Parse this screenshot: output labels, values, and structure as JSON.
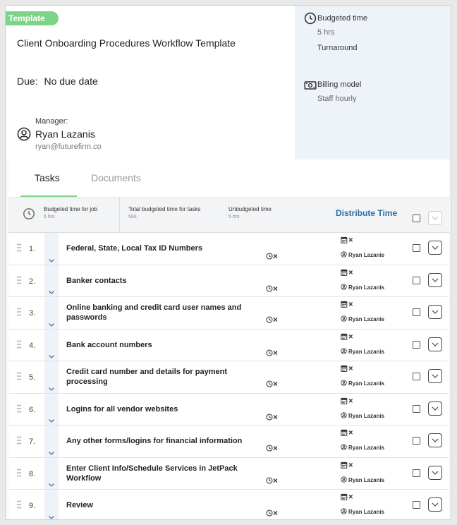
{
  "header": {
    "badge": "Template",
    "title": "Client Onboarding Procedures Workflow Template",
    "due_label": "Due:",
    "due_value": "No due date",
    "manager_label": "Manager:",
    "manager_name": "Ryan Lazanis",
    "manager_email": "ryan@futurefirm.co"
  },
  "sidebar": {
    "budgeted_time_label": "Budgeted time",
    "budgeted_time_value": "5 hrs",
    "turnaround_label": "Turnaround",
    "billing_model_label": "Billing model",
    "billing_model_value": "Staff hourly"
  },
  "tabs": [
    {
      "label": "Tasks",
      "active": true
    },
    {
      "label": "Documents",
      "active": false
    }
  ],
  "summary": {
    "budgeted_for_job_label": "Budgeted time for job",
    "budgeted_for_job_value": "5 hrs",
    "total_budgeted_label": "Total budgeted time for tasks",
    "total_budgeted_value": "N/A",
    "unbudgeted_label": "Unbudgeted time",
    "unbudgeted_value": "5 hrs",
    "distribute_button": "Distribute Time"
  },
  "tasks": [
    {
      "num": "1.",
      "name": "Federal, State, Local Tax ID Numbers",
      "assignee": "Ryan Lazanis"
    },
    {
      "num": "2.",
      "name": "Banker contacts",
      "assignee": "Ryan Lazanis"
    },
    {
      "num": "3.",
      "name": "Online banking and credit card user names and passwords",
      "assignee": "Ryan Lazanis"
    },
    {
      "num": "4.",
      "name": "Bank account numbers",
      "assignee": "Ryan Lazanis"
    },
    {
      "num": "5.",
      "name": "Credit card number and details for payment processing",
      "assignee": "Ryan Lazanis"
    },
    {
      "num": "6.",
      "name": "Logins for all vendor websites",
      "assignee": "Ryan Lazanis"
    },
    {
      "num": "7.",
      "name": "Any other forms/logins for financial information",
      "assignee": "Ryan Lazanis"
    },
    {
      "num": "8.",
      "name": "Enter Client Info/Schedule Services in JetPack Workflow",
      "assignee": "Ryan Lazanis"
    },
    {
      "num": "9.",
      "name": "Review",
      "assignee": "Ryan Lazanis"
    }
  ],
  "colors": {
    "badge_green": "#7ed486",
    "sidebar_bg": "#eef3f9",
    "accent_blue": "#2d6ea3"
  }
}
